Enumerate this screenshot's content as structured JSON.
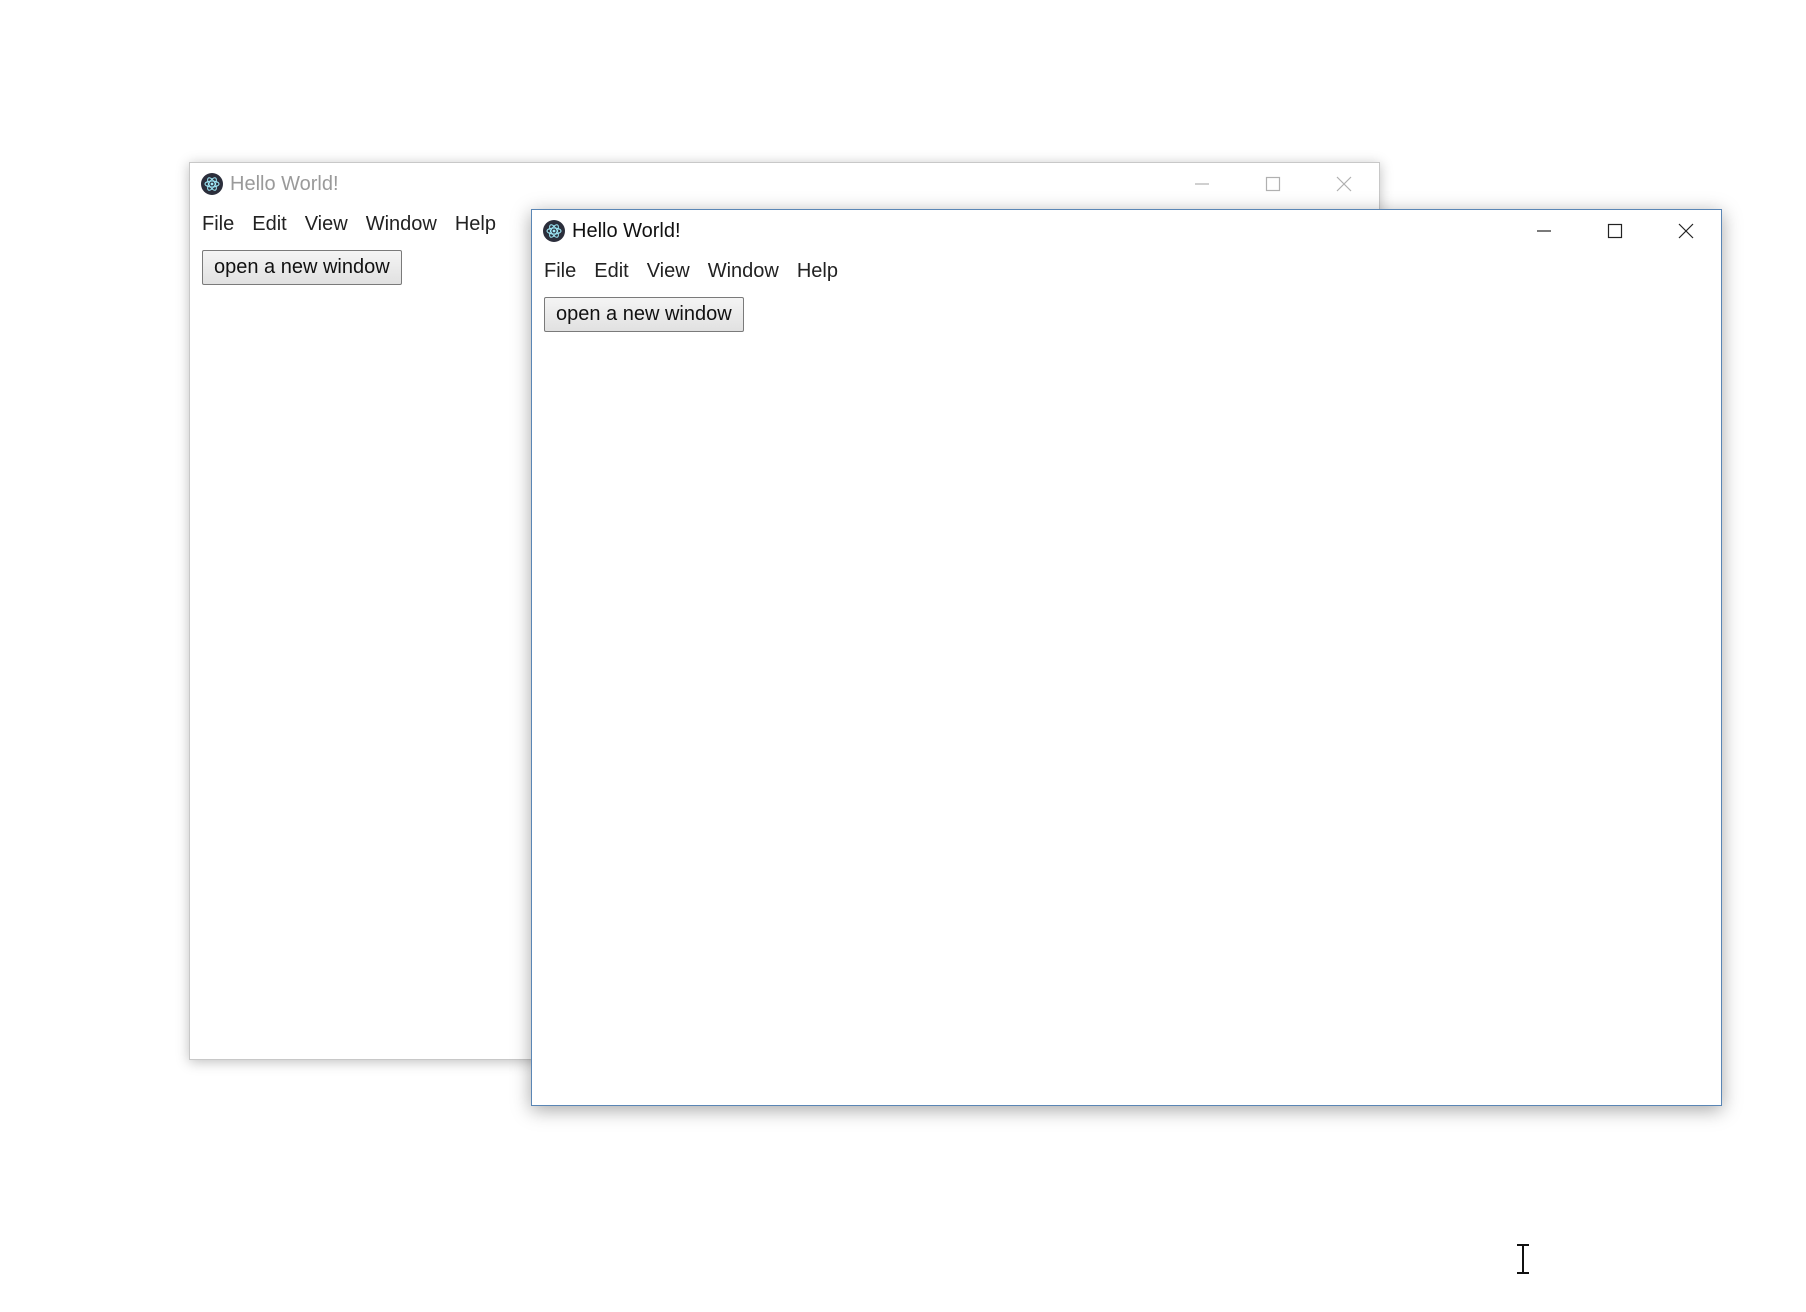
{
  "back_window": {
    "title": "Hello World!",
    "app_icon": "electron-icon",
    "caption_buttons": [
      "minimize-icon",
      "maximize-icon",
      "close-icon"
    ],
    "menu": [
      "File",
      "Edit",
      "View",
      "Window",
      "Help"
    ],
    "button_label": "open a new window",
    "state": "inactive"
  },
  "front_window": {
    "title": "Hello World!",
    "app_icon": "electron-icon",
    "caption_buttons": [
      "minimize-icon",
      "maximize-icon",
      "close-icon"
    ],
    "menu": [
      "File",
      "Edit",
      "View",
      "Window",
      "Help"
    ],
    "button_label": "open a new window",
    "state": "active"
  },
  "cursor": "text-cursor-icon",
  "colors": {
    "active_border": "#5a86b5",
    "inactive_border": "#c8c8c8",
    "inactive_title": "#9a9a9a",
    "active_title": "#111111",
    "background": "#ffffff"
  }
}
